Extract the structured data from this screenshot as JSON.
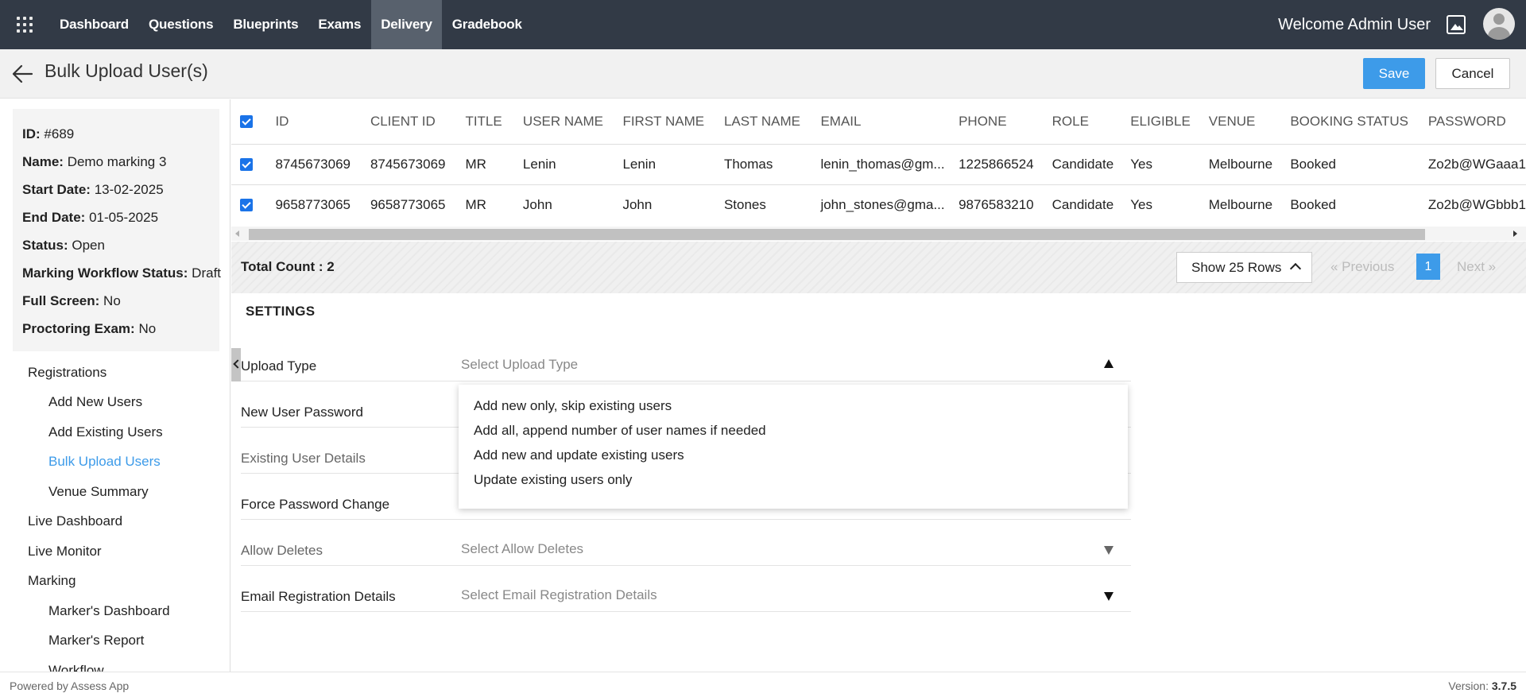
{
  "nav": {
    "items": [
      "Dashboard",
      "Questions",
      "Blueprints",
      "Exams",
      "Delivery",
      "Gradebook"
    ],
    "active": "Delivery",
    "welcome": "Welcome Admin User"
  },
  "header": {
    "title": "Bulk Upload User(s)",
    "save_label": "Save",
    "cancel_label": "Cancel"
  },
  "info": [
    {
      "label": "ID:",
      "value": "#689"
    },
    {
      "label": "Name:",
      "value": "Demo marking 3"
    },
    {
      "label": "Start Date:",
      "value": "13-02-2025"
    },
    {
      "label": "End Date:",
      "value": "01-05-2025"
    },
    {
      "label": "Status:",
      "value": "Open"
    },
    {
      "label": "Marking Workflow Status:",
      "value": "Draft"
    },
    {
      "label": "Full Screen:",
      "value": "No"
    },
    {
      "label": "Proctoring Exam:",
      "value": "No"
    }
  ],
  "sidebar": {
    "items": [
      {
        "label": "Registrations",
        "level": 0,
        "active": false
      },
      {
        "label": "Add New Users",
        "level": 1,
        "active": false
      },
      {
        "label": "Add Existing Users",
        "level": 1,
        "active": false
      },
      {
        "label": "Bulk Upload Users",
        "level": 1,
        "active": true
      },
      {
        "label": "Venue Summary",
        "level": 1,
        "active": false
      },
      {
        "label": "Live Dashboard",
        "level": 0,
        "active": false
      },
      {
        "label": "Live Monitor",
        "level": 0,
        "active": false
      },
      {
        "label": "Marking",
        "level": 0,
        "active": false
      },
      {
        "label": "Marker's Dashboard",
        "level": 1,
        "active": false
      },
      {
        "label": "Marker's Report",
        "level": 1,
        "active": false
      },
      {
        "label": "Workflow",
        "level": 1,
        "active": false
      }
    ]
  },
  "table": {
    "columns": [
      "ID",
      "CLIENT ID",
      "TITLE",
      "USER NAME",
      "FIRST NAME",
      "LAST NAME",
      "EMAIL",
      "PHONE",
      "ROLE",
      "ELIGIBLE",
      "VENUE",
      "BOOKING STATUS",
      "PASSWORD"
    ],
    "rows": [
      [
        "8745673069",
        "8745673069",
        "MR",
        "Lenin",
        "Lenin",
        "Thomas",
        "lenin_thomas@gm...",
        "1225866524",
        "Candidate",
        "Yes",
        "Melbourne",
        "Booked",
        "Zo2b@WGaaa1"
      ],
      [
        "9658773065",
        "9658773065",
        "MR",
        "John",
        "John",
        "Stones",
        "john_stones@gma...",
        "9876583210",
        "Candidate",
        "Yes",
        "Melbourne",
        "Booked",
        "Zo2b@WGbbb1"
      ]
    ],
    "total_count": "Total Count : 2",
    "rows_select": "Show 25 Rows",
    "pager": {
      "previous": "« Previous",
      "page": "1",
      "next": "Next »"
    }
  },
  "settings": {
    "title": "SETTINGS",
    "rows": [
      {
        "label": "Upload Type",
        "value": "Select Upload Type",
        "arrow": "up",
        "dim": false
      },
      {
        "label": "New User Password",
        "value": "",
        "arrow": "",
        "dim": false
      },
      {
        "label": "Existing User Details",
        "value": "",
        "arrow": "",
        "dim": true
      },
      {
        "label": "Force Password Change",
        "value": "",
        "arrow": "",
        "dim": false
      },
      {
        "label": "Allow Deletes",
        "value": "Select Allow Deletes",
        "arrow": "down",
        "dim": true
      },
      {
        "label": "Email Registration Details",
        "value": "Select Email Registration Details",
        "arrow": "down",
        "dim": false
      }
    ],
    "dropdown_options": [
      "Add new only, skip existing users",
      "Add all, append number of user names if needed",
      "Add new and update existing users",
      "Update existing users only"
    ]
  },
  "footer": {
    "powered": "Powered by Assess App",
    "version_label": "Version:",
    "version": "3.7.5"
  }
}
